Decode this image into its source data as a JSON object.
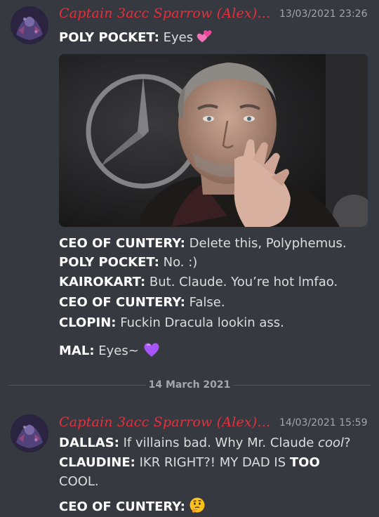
{
  "messages": [
    {
      "author": "Captain 3acc Sparrow (Alex)...",
      "timestamp": "13/03/2021 23:26",
      "lines": [
        {
          "speaker": "POLY POCKET:",
          "text": " Eyes",
          "emoji": "two-hearts"
        }
      ],
      "image_alt": "Photo of a man with grey hair touching his lips"
    },
    {
      "lines": [
        {
          "speaker": "CEO OF CUNTERY:",
          "text": " Delete this, Polyphemus."
        },
        {
          "speaker": "POLY POCKET:",
          "text": " No. :)"
        },
        {
          "speaker": "KAIROKART:",
          "text": " But. Claude. You’re hot lmfao."
        },
        {
          "speaker": "CEO OF CUNTERY:",
          "text": " False."
        },
        {
          "speaker": "CLOPIN:",
          "text": " Fuckin Dracula lookin ass."
        },
        {
          "speaker": "MAL:",
          "text": " Eyes~",
          "emoji": "purple-heart"
        }
      ]
    }
  ],
  "divider": {
    "label": "14 March 2021"
  },
  "second_message": {
    "author": "Captain 3acc Sparrow (Alex)...",
    "timestamp": "14/03/2021 15:59",
    "line1": {
      "speaker": "DALLAS:",
      "text_a": " If villains bad. Why Mr. Claude ",
      "text_italic": "cool",
      "text_b": "?"
    },
    "line2": {
      "speaker": "CLAUDINE:",
      "text_a": " IKR RIGHT?! MY DAD IS ",
      "text_bold": "TOO"
    },
    "line3": {
      "text": "COOL."
    },
    "line4": {
      "speaker": "CEO OF CUNTERY:",
      "emoji": "thinking-face"
    }
  },
  "colors": {
    "background": "#36393f",
    "author": "#e5303d",
    "timestamp": "#a3a6aa",
    "text": "#dcddde"
  }
}
